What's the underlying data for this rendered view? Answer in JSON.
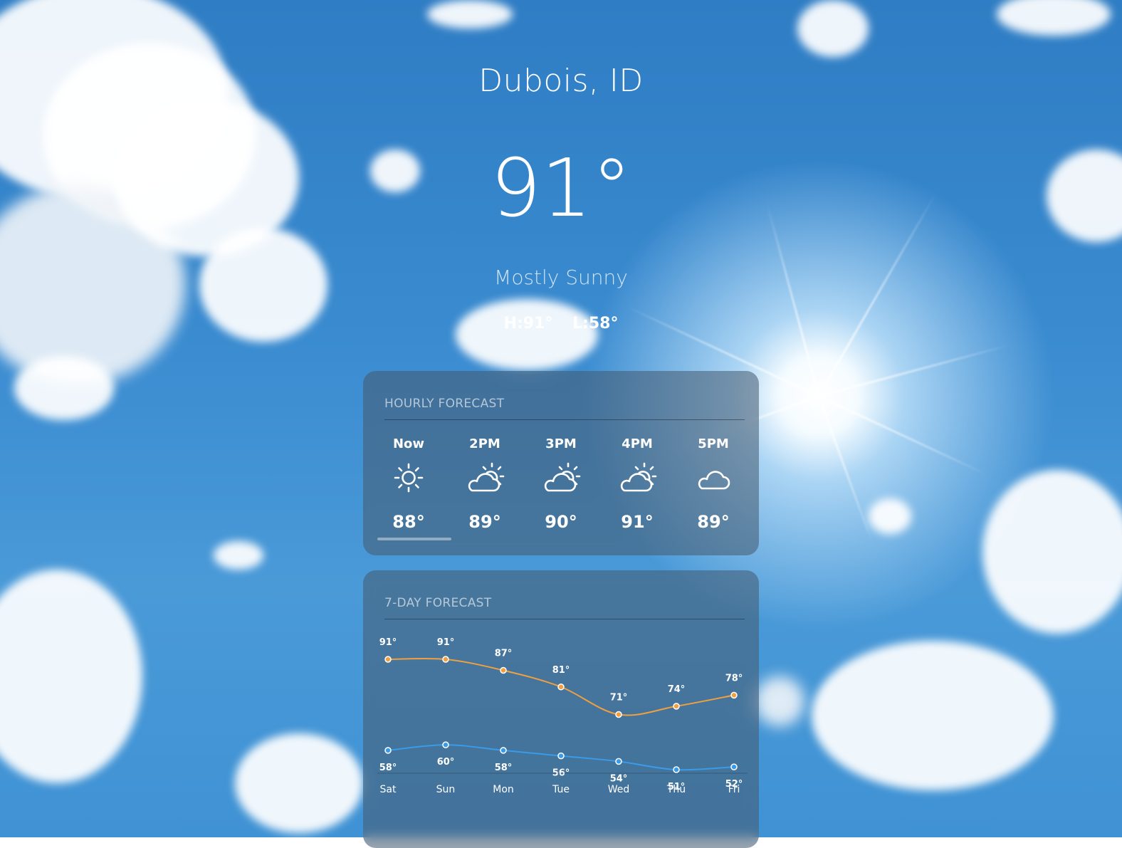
{
  "location": {
    "city": "Dubois, ID"
  },
  "current": {
    "temperature": "91°",
    "condition": "Mostly Sunny",
    "high": "H:91°",
    "low": "L:58°"
  },
  "hourly": {
    "title": "HOURLY FORECAST",
    "items": [
      {
        "time": "Now",
        "icon": "sun-icon",
        "temp": "88°"
      },
      {
        "time": "2PM",
        "icon": "partly-cloudy-icon",
        "temp": "89°"
      },
      {
        "time": "3PM",
        "icon": "partly-cloudy-icon",
        "temp": "90°"
      },
      {
        "time": "4PM",
        "icon": "partly-cloudy-icon",
        "temp": "91°"
      },
      {
        "time": "5PM",
        "icon": "cloud-icon",
        "temp": "89°"
      }
    ]
  },
  "daily": {
    "title": "7-DAY FORECAST"
  },
  "chart_data": {
    "type": "line",
    "x": [
      "Sat",
      "Sun",
      "Mon",
      "Tue",
      "Wed",
      "Thu",
      "Fri"
    ],
    "series": [
      {
        "values": [
          91,
          91,
          87,
          81,
          71,
          74,
          78
        ],
        "labels": [
          "91°",
          "91°",
          "87°",
          "81°",
          "71°",
          "74°",
          "78°"
        ],
        "color": "#f0a040"
      },
      {
        "values": [
          58,
          60,
          58,
          56,
          54,
          51,
          52
        ],
        "labels": [
          "58°",
          "60°",
          "58°",
          "56°",
          "54°",
          "51°",
          "52°"
        ],
        "color": "#3a9be8"
      }
    ],
    "grid": false
  },
  "colors": {
    "high_line": "#f0a040",
    "low_line": "#3a9be8"
  }
}
